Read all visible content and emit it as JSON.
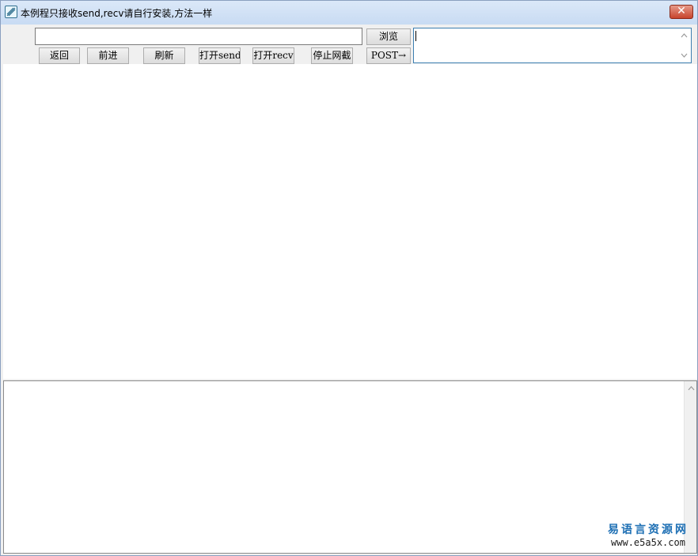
{
  "window": {
    "title": "本例程只接收send,recv请自行安装,方法一样",
    "close_label": "✕"
  },
  "toolbar": {
    "url_value": "",
    "browse_label": "浏览",
    "post_label": "POST→",
    "buttons": [
      {
        "label": "返回"
      },
      {
        "label": "前进"
      },
      {
        "label": "刷新"
      },
      {
        "label": "打开send"
      },
      {
        "label": "打开recv"
      },
      {
        "label": "停止网截"
      }
    ]
  },
  "post_box": {
    "value": ""
  },
  "log": {
    "value": ""
  },
  "watermark": {
    "site_name": "易语言资源网",
    "site_url": "www.e5a5x.com"
  },
  "icons": {
    "app": "app-icon",
    "close": "close-icon",
    "scroll_up": "chevron-up-icon",
    "scroll_down": "chevron-down-icon"
  }
}
